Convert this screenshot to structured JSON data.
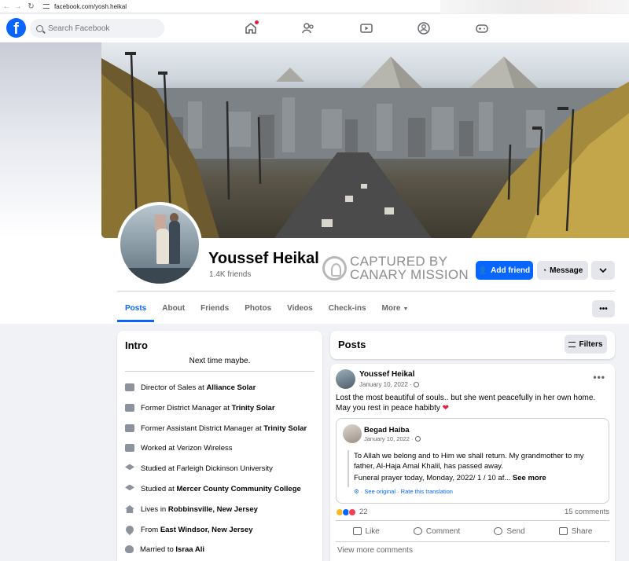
{
  "browser": {
    "url": "facebook.com/yosh.heikal"
  },
  "topbar": {
    "logo": "f",
    "search_placeholder": "Search Facebook",
    "nav_icons": [
      "home-icon",
      "friends-icon",
      "video-icon",
      "groups-icon",
      "gaming-icon"
    ]
  },
  "profile": {
    "name": "Youssef Heikal",
    "friends": "1.4K friends",
    "stamp_line1": "CAPTURED BY",
    "stamp_line2": "CANARY MISSION",
    "add_friend": "Add friend",
    "message": "Message"
  },
  "tabs": [
    "Posts",
    "About",
    "Friends",
    "Photos",
    "Videos",
    "Check-ins",
    "More"
  ],
  "intro": {
    "title": "Intro",
    "bio": "Next time maybe.",
    "items": [
      {
        "prefix": "Director of Sales at ",
        "bold": "Alliance Solar",
        "icon": "work-icon"
      },
      {
        "prefix": "Former District Manager at ",
        "bold": "Trinity Solar",
        "icon": "work-icon"
      },
      {
        "prefix": "Former Assistant District Manager at ",
        "bold": "Trinity Solar",
        "icon": "work-icon"
      },
      {
        "prefix": "Worked at Verizon Wireless",
        "bold": "",
        "icon": "work-icon"
      },
      {
        "prefix": "Studied at Farleigh Dickinson University",
        "bold": "",
        "icon": "education-icon"
      },
      {
        "prefix": "Studied at ",
        "bold": "Mercer County Community College",
        "icon": "education-icon"
      },
      {
        "prefix": "Lives in ",
        "bold": "Robbinsville, New Jersey",
        "icon": "home-icon"
      },
      {
        "prefix": "From ",
        "bold": "East Windsor, New Jersey",
        "icon": "location-icon"
      },
      {
        "prefix": "Married to ",
        "bold": "Israa Ali",
        "icon": "heart-icon"
      }
    ]
  },
  "posts": {
    "title": "Posts",
    "filters": "Filters",
    "post": {
      "author": "Youssef Heikal",
      "date": "January 10, 2022 ·",
      "text": "Lost the most beautiful of souls.. but she went peacefully in her own home. May you rest in peace habibty",
      "shared": {
        "author": "Begad Haiba",
        "date": "January 10, 2022 ·",
        "text": "To Allah we belong and to Him we shall return. My grandmother to my father, Al-Haja Amal Khalil, has passed away.",
        "text2": "Funeral prayer today, Monday, 2022/ 1 / 10 af...",
        "see_more": "See more",
        "see_original": "· See original · Rate this translation"
      },
      "reactions_count": "22",
      "comments_count": "15 comments",
      "actions": [
        "Like",
        "Comment",
        "Send",
        "Share"
      ],
      "view_more": "View more comments"
    }
  }
}
